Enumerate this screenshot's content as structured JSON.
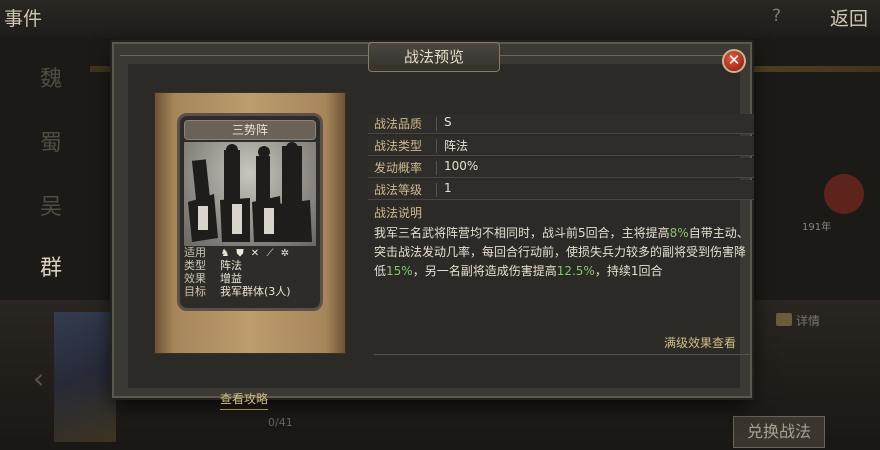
{
  "background": {
    "title": "事件",
    "help_icon": "?",
    "back_label": "返回",
    "tabs": [
      "魏",
      "蜀",
      "吴",
      "群"
    ],
    "active_tab": "群",
    "page_count": "0/41",
    "circle_label": "191年",
    "detail_label": "详情",
    "exchange_button": "兑换战法"
  },
  "modal": {
    "title": "战法预览",
    "close_icon": "close-icon",
    "card": {
      "name": "三势阵",
      "attributes": [
        {
          "key": "适用",
          "icons": [
            "cavalry-icon",
            "shield-icon",
            "crossed-arrows-icon",
            "spear-icon",
            "wheel-icon"
          ]
        },
        {
          "key": "类型",
          "value": "阵法"
        },
        {
          "key": "效果",
          "value": "增益"
        },
        {
          "key": "目标",
          "value": "我军群体(3人)"
        }
      ]
    },
    "stats": [
      {
        "key": "战法品质",
        "value": "S"
      },
      {
        "key": "战法类型",
        "value": "阵法"
      },
      {
        "key": "发动概率",
        "value": "100%"
      },
      {
        "key": "战法等级",
        "value": "1"
      }
    ],
    "description_title": "战法说明",
    "description": {
      "p1": "我军三名武将阵营均不相同时，战斗前5回合，主将提高",
      "h1": "8%",
      "p2": "自带主动、突击战法发动几率，每回合行动前，使损失兵力较多的副将受到伤害降低",
      "h2": "15%",
      "p3": "，另一名副将造成伤害提高",
      "h3": "12.5%",
      "p4": "，持续1回合"
    },
    "full_effect_link": "满级效果查看",
    "strategy_link": "查看攻略"
  },
  "colors": {
    "accent_gold": "#cdb98e",
    "highlight_green": "#84c46a",
    "close_red": "#c0392b"
  }
}
